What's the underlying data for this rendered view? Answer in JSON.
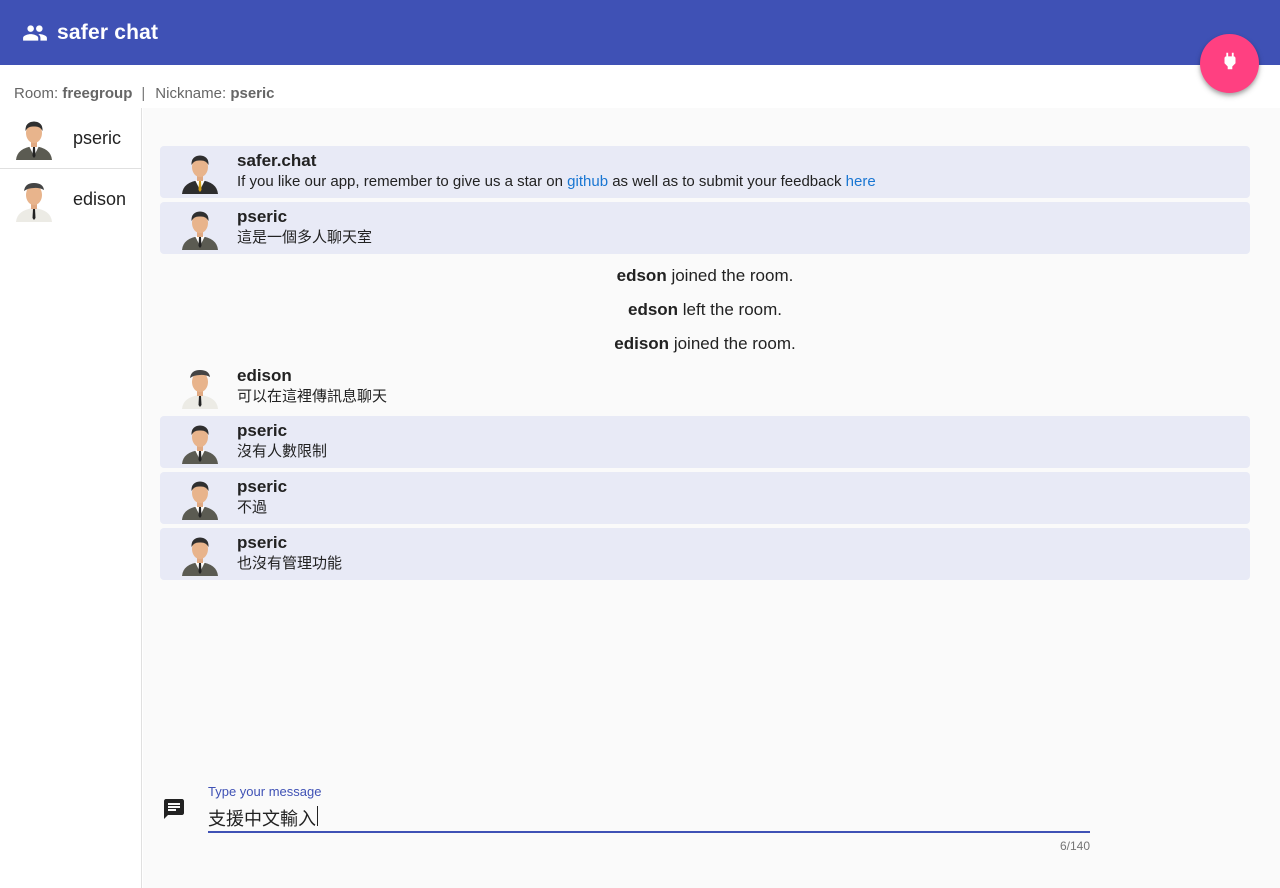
{
  "app": {
    "title": "safer chat",
    "icon": "group-icon"
  },
  "fab": {
    "icon": "plug-icon",
    "color": "#ff4081"
  },
  "theme": {
    "primary": "#3f51b5",
    "accent": "#ff4081",
    "link": "#1976d2",
    "message_bg": "#e8eaf6"
  },
  "info": {
    "room_label": "Room:",
    "room_value": "freegroup",
    "separator": "|",
    "nickname_label": "Nickname:",
    "nickname_value": "pseric"
  },
  "users": [
    {
      "name": "pseric",
      "avatar": "man-suit-avatar"
    },
    {
      "name": "edison",
      "avatar": "man-cap-avatar"
    }
  ],
  "messages": [
    {
      "author": "safer.chat",
      "avatar": "man-suit-avatar",
      "text_before": "If you like our app, remember to give us a star on ",
      "link1": "github",
      "text_middle": " as well as to submit your feedback ",
      "link2": "here"
    },
    {
      "author": "pseric",
      "avatar": "man-suit-avatar",
      "text": "這是一個多人聊天室"
    },
    {
      "author": "edson",
      "text": "joined the room."
    },
    {
      "author": "edson",
      "text": "left the room."
    },
    {
      "author": "edison",
      "text": "joined the room."
    },
    {
      "author": "edison",
      "avatar": "man-cap-avatar",
      "text": "可以在這裡傳訊息聊天"
    },
    {
      "author": "pseric",
      "avatar": "man-suit-avatar",
      "text": "沒有人數限制"
    },
    {
      "author": "pseric",
      "avatar": "man-suit-avatar",
      "text": "不過"
    },
    {
      "author": "pseric",
      "avatar": "man-suit-avatar",
      "text": "也沒有管理功能"
    }
  ],
  "composer": {
    "icon": "chat-icon",
    "label": "Type your message",
    "value": "支援中文輸入",
    "counter": "6/140"
  }
}
